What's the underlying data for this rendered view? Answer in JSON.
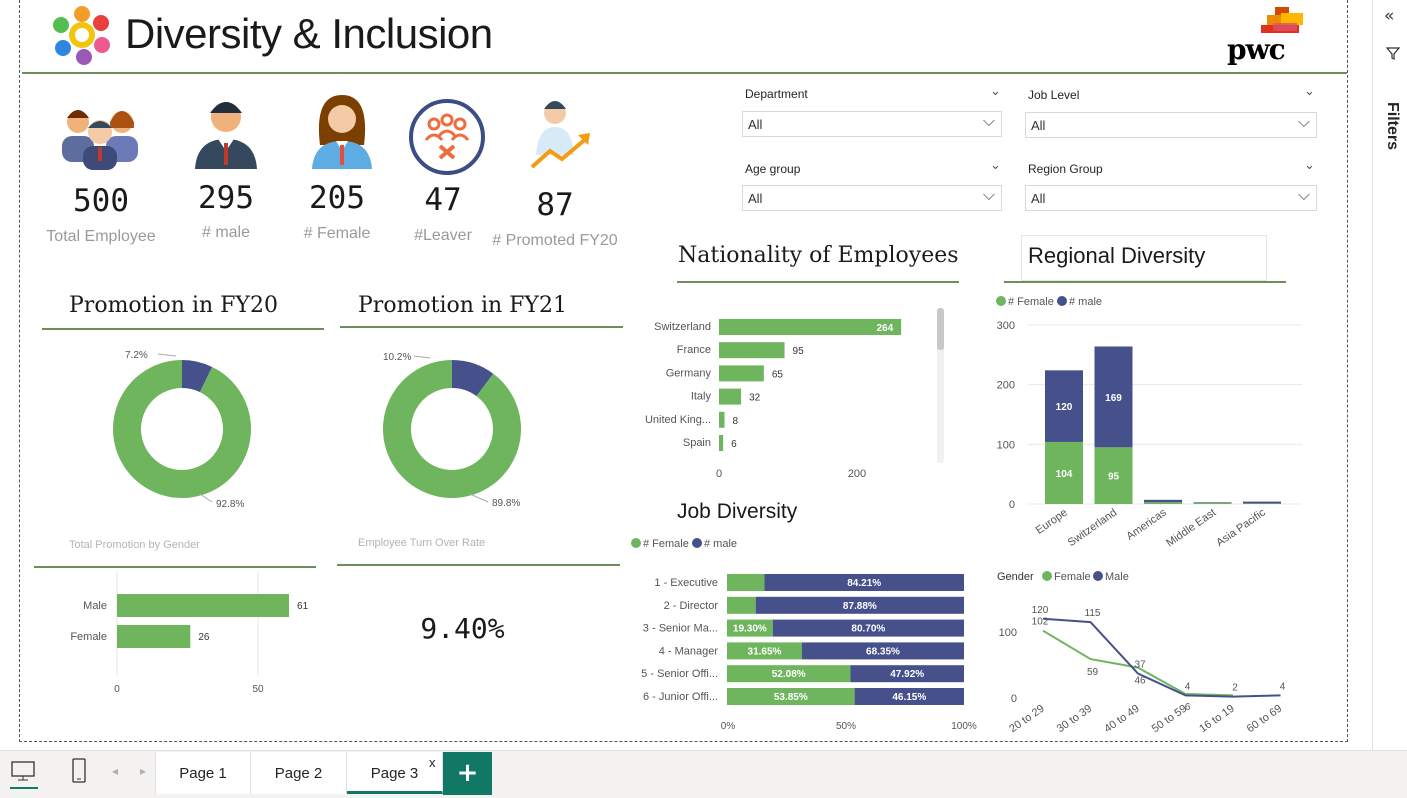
{
  "header": {
    "title": "Diversity & Inclusion",
    "brand": "pwc"
  },
  "kpis": [
    {
      "value": "500",
      "label": "Total Employee"
    },
    {
      "value": "295",
      "label": "# male"
    },
    {
      "value": "205",
      "label": "# Female"
    },
    {
      "value": "47",
      "label": "#Leaver"
    },
    {
      "value": "87",
      "label": "# Promoted FY20"
    }
  ],
  "slicers": [
    {
      "label": "Department",
      "value": "All"
    },
    {
      "label": "Job Level",
      "value": "All"
    },
    {
      "label": "Age group",
      "value": "All"
    },
    {
      "label": "Region Group",
      "value": "All"
    }
  ],
  "sections": {
    "promo20": "Promotion in FY20",
    "promo21": "Promotion in FY21",
    "nationality": "Nationality of Employees",
    "regional": "Regional Diversity",
    "job": "Job Diversity",
    "total_promo_gender": "Total Promotion by Gender",
    "turnover": "Employee Turn Over Rate"
  },
  "turnover_rate": "9.40%",
  "colors": {
    "female": "#6fb55e",
    "male": "#46518c",
    "rule": "#6f8f5a"
  },
  "chart_data": [
    {
      "type": "pie",
      "id": "promo20",
      "title": "Promotion in FY20",
      "labels": [
        "7.2%",
        "92.8%"
      ],
      "values": [
        7.2,
        92.8
      ],
      "donut": true
    },
    {
      "type": "pie",
      "id": "promo21",
      "title": "Promotion in FY21",
      "labels": [
        "10.2%",
        "89.8%"
      ],
      "values": [
        10.2,
        89.8
      ],
      "donut": true
    },
    {
      "type": "bar",
      "id": "nationality",
      "title": "Nationality of Employees",
      "orientation": "horizontal",
      "categories": [
        "Switzerland",
        "France",
        "Germany",
        "Italy",
        "United King...",
        "Spain"
      ],
      "values": [
        264,
        95,
        65,
        32,
        8,
        6
      ],
      "xticks": [
        "0",
        "200"
      ],
      "xlim": [
        0,
        310
      ]
    },
    {
      "type": "bar",
      "id": "regional",
      "title": "Regional Diversity",
      "stacked": true,
      "categories": [
        "Europe",
        "Switzerland",
        "Americas",
        "Middle East",
        "Asia Pacific"
      ],
      "legend": [
        "# Female",
        "# male"
      ],
      "series": [
        {
          "name": "# Female",
          "values": [
            104,
            95,
            3,
            2,
            1
          ]
        },
        {
          "name": "# male",
          "values": [
            120,
            169,
            4,
            1,
            3
          ]
        }
      ],
      "yticks": [
        "0",
        "100",
        "200",
        "300"
      ],
      "ylim": [
        0,
        300
      ],
      "grid": true
    },
    {
      "type": "bar",
      "id": "job",
      "title": "Job Diversity",
      "stacked": true,
      "percent": true,
      "orientation": "horizontal",
      "categories": [
        "1 - Executive",
        "2 - Director",
        "3 - Senior Ma...",
        "4 - Manager",
        "5 - Senior Offi...",
        "6 - Junior Offi..."
      ],
      "legend": [
        "# Female",
        "# male"
      ],
      "series": [
        {
          "name": "# Female",
          "values": [
            15.79,
            12.12,
            19.3,
            31.65,
            52.08,
            53.85
          ],
          "labels": [
            "",
            "",
            "19.30%",
            "31.65%",
            "52.08%",
            "53.85%"
          ]
        },
        {
          "name": "# male",
          "values": [
            84.21,
            87.88,
            80.7,
            68.35,
            47.92,
            46.15
          ],
          "labels": [
            "84.21%",
            "87.88%",
            "80.70%",
            "68.35%",
            "47.92%",
            "46.15%"
          ]
        }
      ],
      "xticks": [
        "0%",
        "50%",
        "100%"
      ]
    },
    {
      "type": "bar",
      "id": "promo_gender",
      "title": "Total Promotion by Gender",
      "orientation": "horizontal",
      "categories": [
        "Male",
        "Female"
      ],
      "values": [
        61,
        26
      ],
      "xticks": [
        "0",
        "50"
      ],
      "xlim": [
        0,
        70
      ]
    },
    {
      "type": "line",
      "id": "age_gender",
      "legend_title": "Gender",
      "legend": [
        "Female",
        "Male"
      ],
      "categories": [
        "20 to 29",
        "30 to 39",
        "40 to 49",
        "50 to 59",
        "16 to 19",
        "60 to 69"
      ],
      "series": [
        {
          "name": "Female",
          "values": [
            102,
            59,
            46,
            6,
            4,
            null
          ],
          "labels": [
            "102",
            "59",
            "46",
            "6",
            "",
            ""
          ]
        },
        {
          "name": "Male",
          "values": [
            120,
            115,
            37,
            4,
            2,
            4
          ],
          "labels": [
            "120",
            "115",
            "37",
            "4",
            "2",
            "4"
          ]
        }
      ],
      "yticks": [
        "0",
        "100"
      ],
      "ylim": [
        0,
        130
      ]
    }
  ],
  "filters_pane": {
    "label": "Filters"
  },
  "tabs": [
    {
      "label": "Page 1"
    },
    {
      "label": "Page 2"
    },
    {
      "label": "Page 3",
      "active": true
    }
  ],
  "tab_close": "x",
  "add_tab": "+"
}
